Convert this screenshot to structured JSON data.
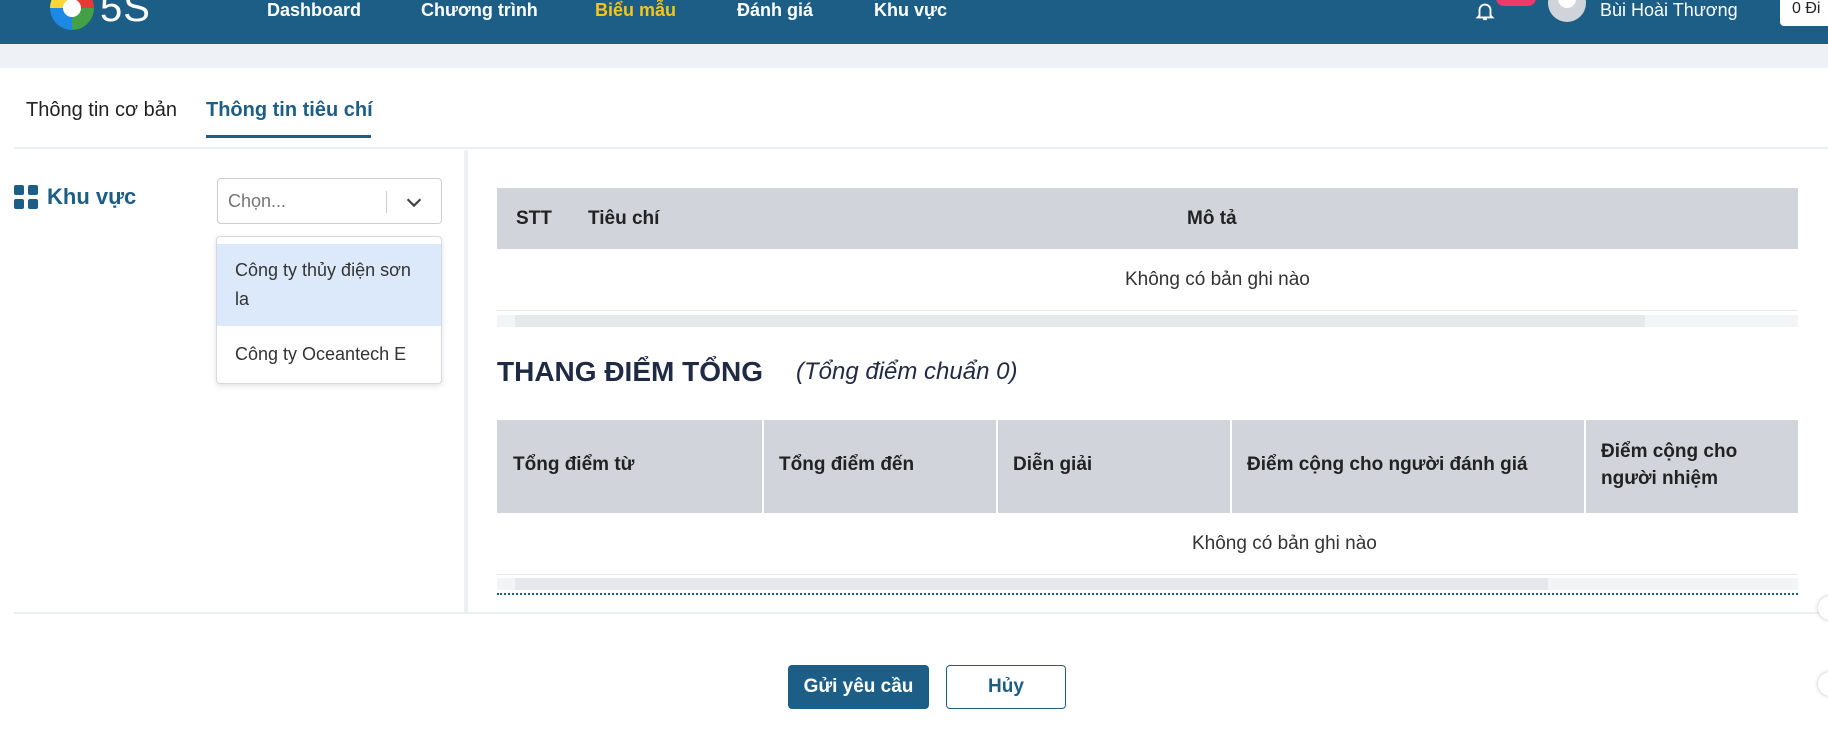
{
  "app": {
    "logo_text": "5S"
  },
  "nav": {
    "items": [
      "Dashboard",
      "Chương trình",
      "Biểu mẫu",
      "Đánh giá",
      "Khu vực"
    ]
  },
  "user": {
    "name": "Bùi Hoài Thương",
    "points": "0 Đi"
  },
  "tabs": [
    "Thông tin cơ bản",
    "Thông tin tiêu chí"
  ],
  "area": {
    "label": "Khu vực",
    "placeholder": "Chọn...",
    "options": [
      "Công ty thủy điện sơn la",
      "Công ty Oceantech E"
    ]
  },
  "criteria_table": {
    "headers": [
      "STT",
      "Tiêu chí",
      "Mô tả"
    ],
    "empty_text": "Không có bản ghi nào"
  },
  "totals": {
    "title": "THANG ĐIỂM TỔNG",
    "subtitle": "(Tổng điểm chuẩn 0)",
    "headers": [
      "Tổng điểm từ",
      "Tổng điểm đến",
      "Diễn giải",
      "Điểm cộng cho người đánh giá",
      "Điểm cộng cho người nhiệm"
    ],
    "empty_text": "Không có bản ghi nào"
  },
  "actions": {
    "submit": "Gửi yêu cầu",
    "cancel": "Hủy"
  },
  "colors": {
    "primary": "#1c5e86",
    "nav_active": "#f5c518",
    "badge": "#f0386b",
    "header_cell": "#d1d5db"
  }
}
